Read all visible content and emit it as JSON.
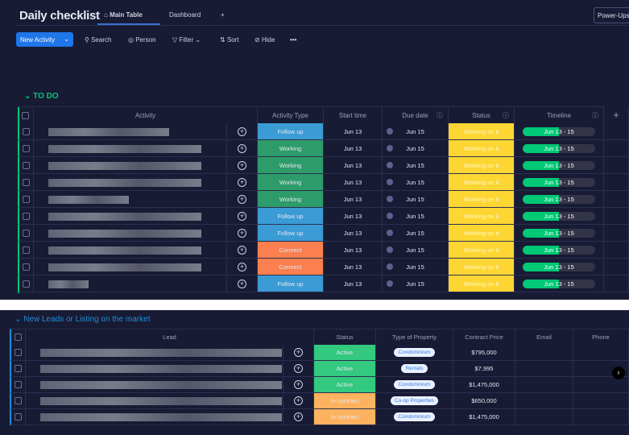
{
  "header": {
    "title": "Daily checklist",
    "tabs": [
      {
        "label": "Main Table",
        "icon": "home-icon"
      },
      {
        "label": "Dashboard"
      }
    ],
    "add_tab": "+",
    "power_ups": "Power-Ups"
  },
  "toolbar": {
    "new_label": "New Activity",
    "search": "Search",
    "person": "Person",
    "filter": "Filter",
    "sort": "Sort",
    "hide": "Hide",
    "more": "•••"
  },
  "todo": {
    "title": "TO DO",
    "color": "#00c875",
    "columns": [
      "Activity",
      "Activity Type",
      "Start time",
      "Due date",
      "Status",
      "Timeline"
    ],
    "rows": [
      {
        "type": "Follow up",
        "start": "Jun 13",
        "due": "Jun 15",
        "status": "Working on it",
        "timeline": "Jun 13 - 15"
      },
      {
        "type": "Working",
        "start": "Jun 13",
        "due": "Jun 15",
        "status": "Working on it",
        "timeline": "Jun 13 - 15"
      },
      {
        "type": "Working",
        "start": "Jun 13",
        "due": "Jun 15",
        "status": "Working on it",
        "timeline": "Jun 13 - 15"
      },
      {
        "type": "Working",
        "start": "Jun 13",
        "due": "Jun 15",
        "status": "Working on it",
        "timeline": "Jun 13 - 15"
      },
      {
        "type": "Working",
        "start": "Jun 13",
        "due": "Jun 15",
        "status": "Working on it",
        "timeline": "Jun 13 - 15"
      },
      {
        "type": "Follow up",
        "start": "Jun 13",
        "due": "Jun 15",
        "status": "Working on it",
        "timeline": "Jun 13 - 15"
      },
      {
        "type": "Follow up",
        "start": "Jun 13",
        "due": "Jun 15",
        "status": "Working on it",
        "timeline": "Jun 13 - 15"
      },
      {
        "type": "Connect",
        "start": "Jun 13",
        "due": "Jun 15",
        "status": "Working on it",
        "timeline": "Jun 13 - 15"
      },
      {
        "type": "Connect",
        "start": "Jun 13",
        "due": "Jun 15",
        "status": "Working on it",
        "timeline": "Jun 13 - 15"
      },
      {
        "type": "Follow up",
        "start": "Jun 13",
        "due": "Jun 15",
        "status": "Working on it",
        "timeline": "Jun 13 - 15"
      }
    ],
    "type_colors": {
      "Follow up": "#3a9bd5",
      "Working": "#2e9b6a",
      "Connect": "#fc7f4f"
    },
    "status_color": "#fdd633",
    "timeline_progress": 0.5
  },
  "leads": {
    "title": "New Leads or Listing on the market",
    "color": "#1f8ed6",
    "columns": [
      "Lead",
      "Status",
      "Type of Property",
      "Contract Price",
      "Email",
      "Phone"
    ],
    "rows": [
      {
        "status": "Active",
        "type": "Condominium",
        "price": "$795,000"
      },
      {
        "status": "Active",
        "type": "Rentals",
        "price": "$7,995"
      },
      {
        "status": "Active",
        "type": "Condominium",
        "price": "$1,475,000"
      },
      {
        "status": "In contract",
        "type": "Co-op Properties",
        "price": "$650,000"
      },
      {
        "status": "In contract",
        "type": "Condominium",
        "price": "$1,475,000"
      }
    ],
    "status_colors": {
      "Active": "#33c97f",
      "In contract": "#fdb25f"
    }
  }
}
